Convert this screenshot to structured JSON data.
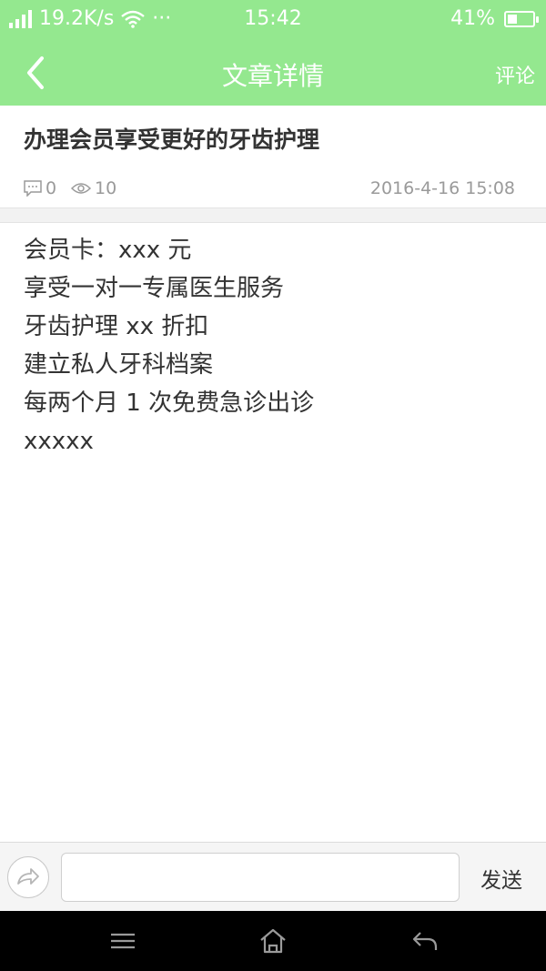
{
  "status_bar": {
    "speed": "19.2K/s",
    "dots": "···",
    "time": "15:42",
    "battery_text": "41%",
    "battery_level": 0.41
  },
  "nav": {
    "title": "文章详情",
    "comment_label": "评论"
  },
  "article": {
    "title": "办理会员享受更好的牙齿护理",
    "comment_count": "0",
    "view_count": "10",
    "date": "2016-4-16 15:08",
    "lines": [
      "会员卡：xxx 元",
      "享受一对一专属医生服务",
      "牙齿护理 xx 折扣",
      "建立私人牙科档案",
      "每两个月 1 次免费急诊出诊",
      "xxxxx"
    ]
  },
  "input_bar": {
    "input_value": "",
    "send_label": "发送"
  },
  "colors": {
    "header_green": "#94e88f",
    "meta_gray": "#9a9a9a"
  }
}
